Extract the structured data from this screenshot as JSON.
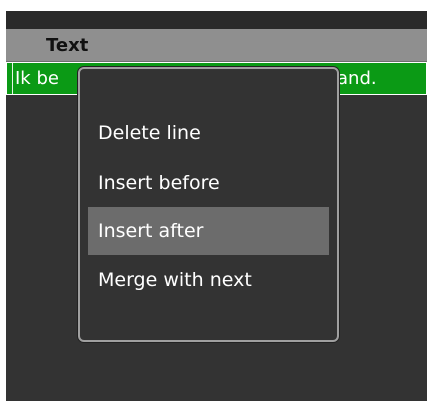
{
  "table": {
    "header": {
      "column_text": "Text"
    },
    "selected_row": {
      "text_visible_left": "Ik be",
      "text_visible_right": "and."
    }
  },
  "context_menu": {
    "items": [
      {
        "label": "Delete line",
        "highlighted": false
      },
      {
        "label": "Insert before",
        "highlighted": false
      },
      {
        "label": "Insert after",
        "highlighted": true
      },
      {
        "label": "Merge with next",
        "highlighted": false
      }
    ]
  },
  "colors": {
    "header_bg": "#8f8f8f",
    "selected_row_bg": "#0b9a15",
    "panel_bg": "#333333",
    "menu_border": "#a0a0a0",
    "menu_highlight": "#6c6c6c"
  }
}
